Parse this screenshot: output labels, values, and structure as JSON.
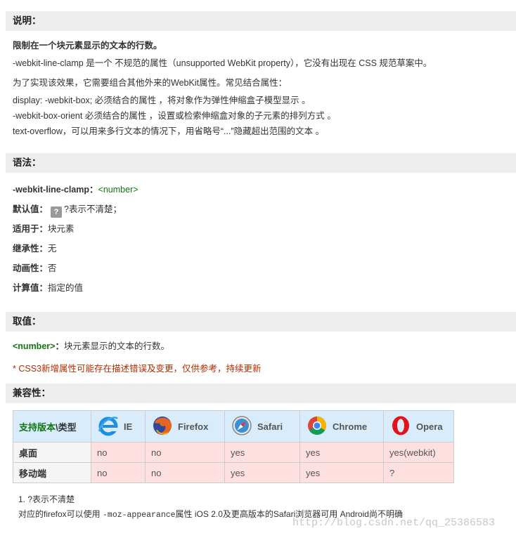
{
  "intro": {
    "header": "说明：",
    "summary": "限制在一个块元素显示的文本的行数。",
    "desc1": "-webkit-line-clamp 是一个 不规范的属性（unsupported WebKit property），它没有出现在 CSS 规范草案中。",
    "desc2": "为了实现该效果，它需要组合其他外来的WebKit属性。常见结合属性：",
    "combo1": "display: -webkit-box; 必须结合的属性 ，将对象作为弹性伸缩盒子模型显示 。",
    "combo2": "-webkit-box-orient 必须结合的属性 ，设置或检索伸缩盒对象的子元素的排列方式 。",
    "combo3": "text-overflow，可以用来多行文本的情况下，用省略号“...”隐藏超出范围的文本 。"
  },
  "syntax": {
    "header": "语法：",
    "prop_name": "-webkit-line-clamp：",
    "prop_value": "<number>",
    "default_label": "默认值：",
    "default_badge": "?",
    "default_text": "?表示不清楚；",
    "applies_label": "适用于：",
    "applies_value": "块元素",
    "inherit_label": "继承性：",
    "inherit_value": "无",
    "animate_label": "动画性：",
    "animate_value": "否",
    "computed_label": "计算值：",
    "computed_value": "指定的值"
  },
  "values": {
    "header": "取值：",
    "number_label": "<number>",
    "number_colon": "：",
    "number_desc": "块元素显示的文本的行数。",
    "warning": "* CSS3新增属性可能存在描述错误及变更，仅供参考，持续更新"
  },
  "compat": {
    "header": "兼容性：",
    "type_header_a": "支持版本",
    "type_header_b": "\\类型",
    "browsers": [
      {
        "name": "IE",
        "icon": "ie-icon"
      },
      {
        "name": "Firefox",
        "icon": "firefox-icon"
      },
      {
        "name": "Safari",
        "icon": "safari-icon"
      },
      {
        "name": "Chrome",
        "icon": "chrome-icon"
      },
      {
        "name": "Opera",
        "icon": "opera-icon"
      }
    ],
    "rows": [
      {
        "label": "桌面",
        "cells": [
          "no",
          "no",
          "yes",
          "yes",
          "yes(webkit)"
        ]
      },
      {
        "label": "移动端",
        "cells": [
          "no",
          "no",
          "yes",
          "yes",
          "?"
        ]
      }
    ],
    "footnote1": "1. ?表示不清楚",
    "footnote2_a": "对应的firefox可以使用 ",
    "footnote2_code": "-moz-appearance",
    "footnote2_b": "属性      iOS 2.0及更高版本的Safari浏览器可用      Android尚不明确"
  },
  "watermark": "http://blog.csdn.net/qq_25386583"
}
